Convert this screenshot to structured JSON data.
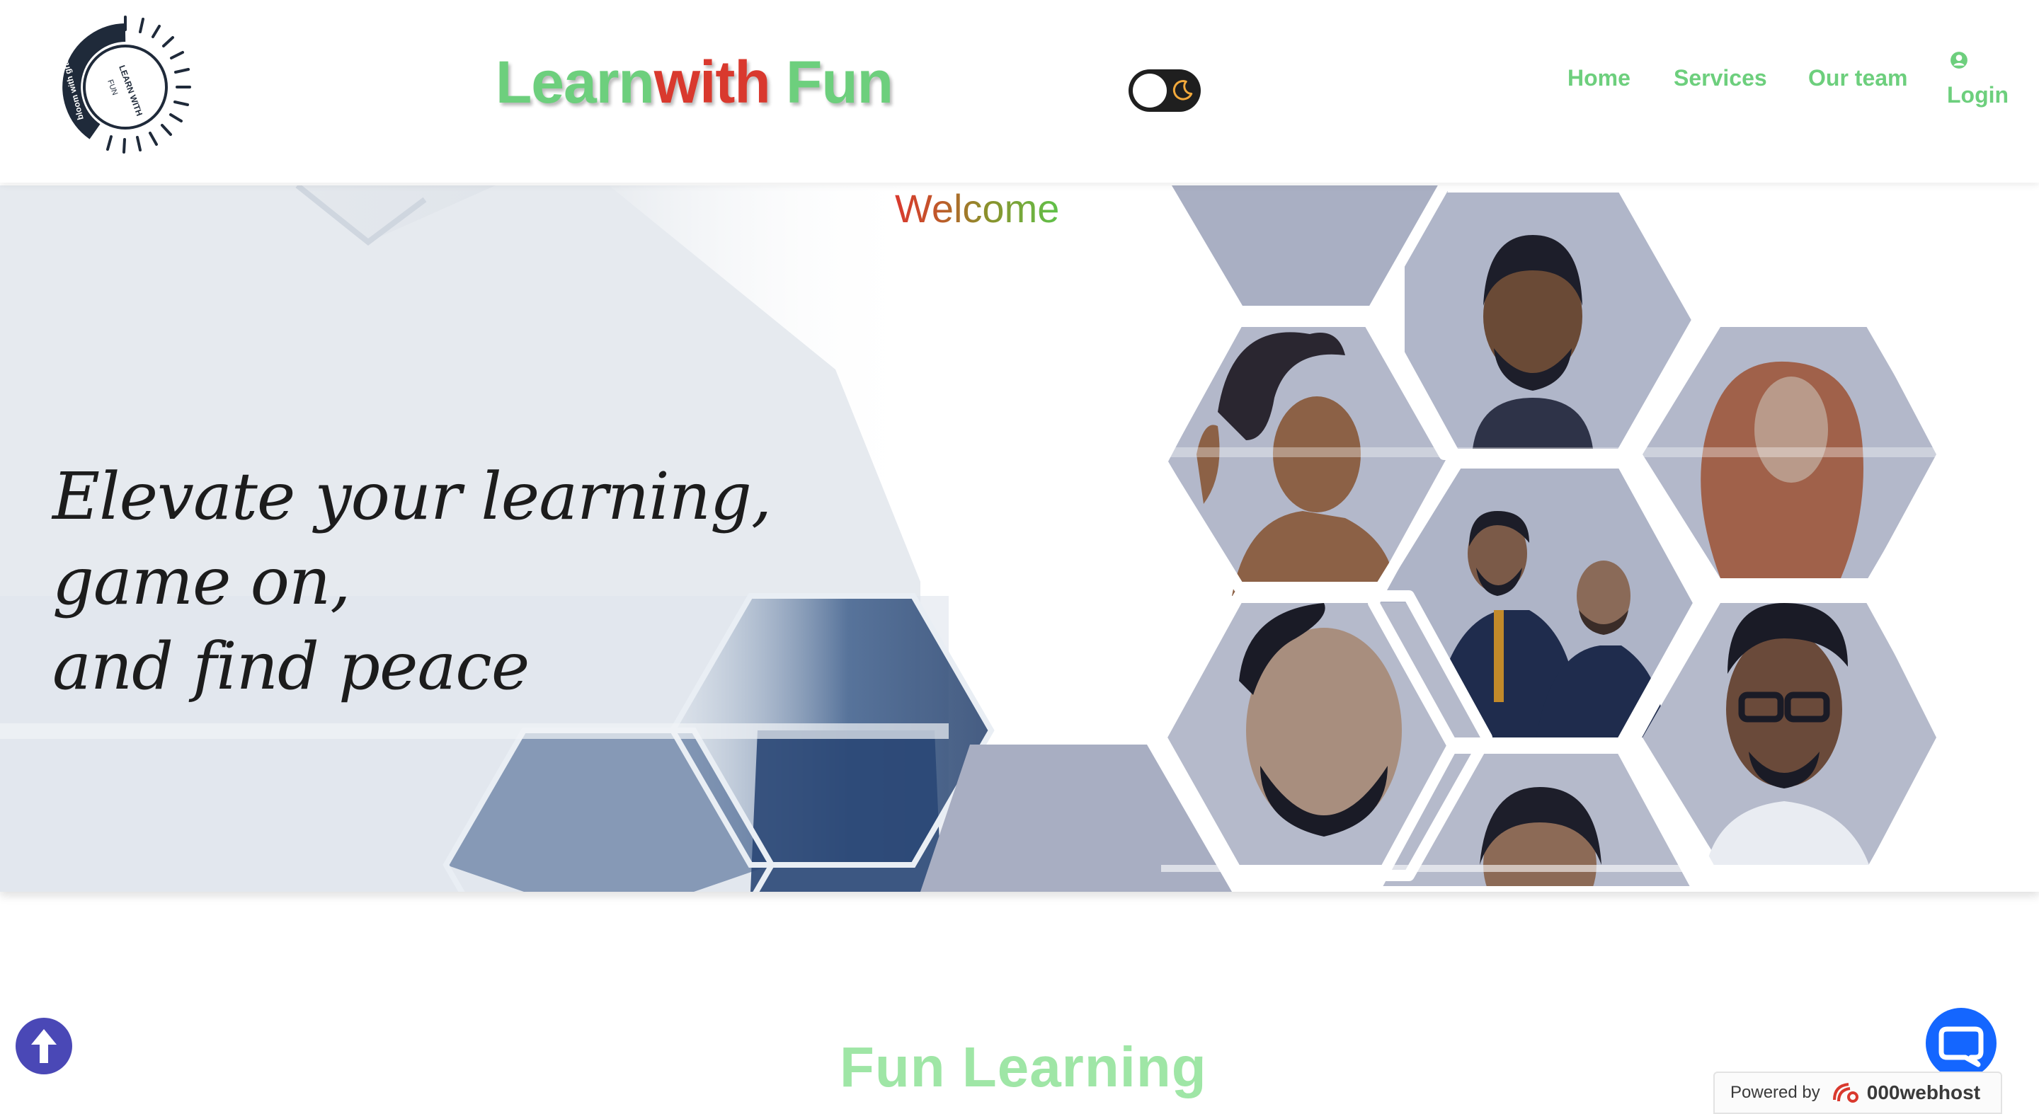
{
  "header": {
    "logo_text_top": "LEARN WITH",
    "logo_text_bottom": "FUN",
    "logo_ring_text": "bloom with grace",
    "title_part1": "Learn",
    "title_part2": "with",
    "title_part3": " Fun",
    "theme_toggle_icon": "moon-icon"
  },
  "nav": {
    "home": "Home",
    "services": "Services",
    "team": "Our team",
    "login": "Login",
    "login_icon": "user-circle-icon"
  },
  "hero": {
    "welcome": "Welcome",
    "tagline_line1": "Elevate your learning,",
    "tagline_line2": "game on,",
    "tagline_line3": "and find peace"
  },
  "section": {
    "title": "Fun Learning"
  },
  "widgets": {
    "scroll_top_icon": "arrow-up-icon",
    "chat_icon": "chat-bubble-icon",
    "powered_by": "Powered by",
    "powered_brand": "000webhost"
  },
  "colors": {
    "accent_green": "#6dcf7d",
    "accent_red": "#d9392e",
    "scroll_button": "#4a48b6",
    "chat_button": "#1466ff"
  }
}
